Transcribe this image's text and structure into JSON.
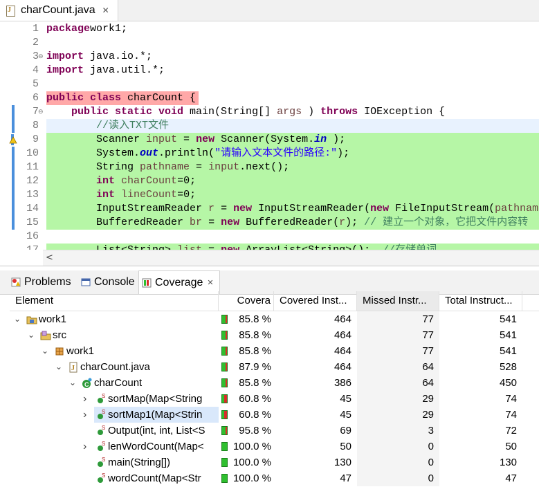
{
  "editor": {
    "tab_title": "charCount.java",
    "tab_close": "✕",
    "lines": [
      {
        "n": "1",
        "bg": "",
        "segs": [
          [
            "kw",
            "package"
          ],
          [
            "",
            "work1;"
          ]
        ]
      },
      {
        "n": "2",
        "bg": "",
        "segs": []
      },
      {
        "n": "3",
        "bg": "",
        "fold": "⊖",
        "segs": [
          [
            "kw",
            "import"
          ],
          [
            "",
            " java.io.*;"
          ]
        ]
      },
      {
        "n": "4",
        "bg": "",
        "segs": [
          [
            "kw",
            "import"
          ],
          [
            "",
            " java.util.*;"
          ]
        ]
      },
      {
        "n": "5",
        "bg": "",
        "segs": []
      },
      {
        "n": "6",
        "bg": "red",
        "segs": [
          [
            "kw",
            "public class"
          ],
          [
            "",
            " charCount {"
          ]
        ]
      },
      {
        "n": "7",
        "bg": "",
        "fold": "⊖",
        "mark": "bar",
        "segs": [
          [
            "",
            "    "
          ],
          [
            "kw",
            "public static void"
          ],
          [
            "",
            " main(String[] "
          ],
          [
            "lv",
            "args"
          ],
          [
            "",
            " ) "
          ],
          [
            "kw",
            "throws"
          ],
          [
            "",
            " IOException {"
          ]
        ]
      },
      {
        "n": "8",
        "bg": "cur",
        "mark": "bar",
        "segs": [
          [
            "",
            "        "
          ],
          [
            "cm",
            "//读入TXT文件"
          ]
        ]
      },
      {
        "n": "9",
        "bg": "green",
        "mark": "warn",
        "segs": [
          [
            "",
            "        Scanner "
          ],
          [
            "lv",
            "input"
          ],
          [
            "",
            " = "
          ],
          [
            "kw",
            "new"
          ],
          [
            "",
            " Scanner(System."
          ],
          [
            "fld",
            "in"
          ],
          [
            "",
            " );"
          ]
        ]
      },
      {
        "n": "10",
        "bg": "green",
        "mark": "bar",
        "segs": [
          [
            "",
            "        System."
          ],
          [
            "fld",
            "out"
          ],
          [
            "",
            ".println("
          ],
          [
            "st",
            "\"请输入文本文件的路径:\""
          ],
          [
            "",
            ");"
          ]
        ]
      },
      {
        "n": "11",
        "bg": "green",
        "mark": "bar",
        "segs": [
          [
            "",
            "        String "
          ],
          [
            "lv",
            "pathname"
          ],
          [
            "",
            " = "
          ],
          [
            "lv",
            "input"
          ],
          [
            "",
            ".next();"
          ]
        ]
      },
      {
        "n": "12",
        "bg": "green",
        "mark": "bar",
        "segs": [
          [
            "",
            "        "
          ],
          [
            "kw",
            "int"
          ],
          [
            "",
            " "
          ],
          [
            "lv",
            "charCount"
          ],
          [
            "",
            "=0;"
          ]
        ]
      },
      {
        "n": "13",
        "bg": "green",
        "mark": "bar",
        "segs": [
          [
            "",
            "        "
          ],
          [
            "kw",
            "int"
          ],
          [
            "",
            " "
          ],
          [
            "lv",
            "lineCount"
          ],
          [
            "",
            "=0;"
          ]
        ]
      },
      {
        "n": "14",
        "bg": "green",
        "mark": "bar",
        "segs": [
          [
            "",
            "        InputStreamReader "
          ],
          [
            "lv",
            "r"
          ],
          [
            "",
            " = "
          ],
          [
            "kw",
            "new"
          ],
          [
            "",
            " InputStreamReader("
          ],
          [
            "kw",
            "new"
          ],
          [
            "",
            " FileInputStream("
          ],
          [
            "lv",
            "pathnam"
          ]
        ]
      },
      {
        "n": "15",
        "bg": "green",
        "mark": "bar",
        "segs": [
          [
            "",
            "        BufferedReader "
          ],
          [
            "lv",
            "br"
          ],
          [
            "",
            " = "
          ],
          [
            "kw",
            "new"
          ],
          [
            "",
            " BufferedReader("
          ],
          [
            "lv",
            "r"
          ],
          [
            "",
            "); "
          ],
          [
            "cm",
            "// 建立一个对象，它把文件内容转"
          ]
        ]
      },
      {
        "n": "16",
        "bg": "",
        "segs": []
      },
      {
        "n": "17",
        "bg": "green",
        "segs": [
          [
            "",
            "        List<String> "
          ],
          [
            "lv",
            "list"
          ],
          [
            "",
            " = "
          ],
          [
            "kw",
            "new"
          ],
          [
            "",
            " ArrayList<String>();  "
          ],
          [
            "cm",
            "//存储单词"
          ]
        ]
      }
    ],
    "hscroll_arrow": "<"
  },
  "views": {
    "tabs": [
      {
        "label": "Problems",
        "icon": "problems-icon",
        "active": false
      },
      {
        "label": "Console",
        "icon": "console-icon",
        "active": false
      },
      {
        "label": "Coverage",
        "icon": "coverage-icon",
        "active": true,
        "close": "✕"
      }
    ],
    "columns": [
      "Element",
      "Covera",
      "Covered Inst...",
      "Missed Instr...",
      "Total Instruct..."
    ],
    "rows": [
      {
        "indent": 0,
        "twisty": "⌄",
        "icon": "project-icon",
        "name": "work1",
        "coverage": "85.8 %",
        "miss_frac": 0.142,
        "covered": "464",
        "missed": "77",
        "total": "541"
      },
      {
        "indent": 1,
        "twisty": "⌄",
        "icon": "source-folder-icon",
        "name": "src",
        "coverage": "85.8 %",
        "miss_frac": 0.142,
        "covered": "464",
        "missed": "77",
        "total": "541"
      },
      {
        "indent": 2,
        "twisty": "⌄",
        "icon": "package-icon",
        "name": "work1",
        "coverage": "85.8 %",
        "miss_frac": 0.142,
        "covered": "464",
        "missed": "77",
        "total": "541"
      },
      {
        "indent": 3,
        "twisty": "⌄",
        "icon": "java-file-icon",
        "name": "charCount.java",
        "coverage": "87.9 %",
        "miss_frac": 0.121,
        "covered": "464",
        "missed": "64",
        "total": "528"
      },
      {
        "indent": 4,
        "twisty": "⌄",
        "icon": "class-icon",
        "name": "charCount",
        "coverage": "85.8 %",
        "miss_frac": 0.142,
        "covered": "386",
        "missed": "64",
        "total": "450"
      },
      {
        "indent": 5,
        "twisty": "›",
        "icon": "static-method-icon",
        "name": "sortMap(Map<String",
        "coverage": "60.8 %",
        "miss_frac": 0.392,
        "covered": "45",
        "missed": "29",
        "total": "74"
      },
      {
        "indent": 5,
        "twisty": "›",
        "icon": "static-method-icon",
        "name": "sortMap1(Map<Strin",
        "coverage": "60.8 %",
        "miss_frac": 0.392,
        "covered": "45",
        "missed": "29",
        "total": "74",
        "selected": true
      },
      {
        "indent": 5,
        "twisty": "",
        "icon": "static-method-icon",
        "name": "Output(int, int, List<S",
        "coverage": "95.8 %",
        "miss_frac": 0.042,
        "covered": "69",
        "missed": "3",
        "total": "72"
      },
      {
        "indent": 5,
        "twisty": "›",
        "icon": "static-method-icon",
        "name": "lenWordCount(Map<",
        "coverage": "100.0 %",
        "miss_frac": 0,
        "covered": "50",
        "missed": "0",
        "total": "50"
      },
      {
        "indent": 5,
        "twisty": "",
        "icon": "static-method-icon",
        "name": "main(String[])",
        "coverage": "100.0 %",
        "miss_frac": 0,
        "covered": "130",
        "missed": "0",
        "total": "130"
      },
      {
        "indent": 5,
        "twisty": "",
        "icon": "static-method-icon",
        "name": "wordCount(Map<Str",
        "coverage": "100.0 %",
        "miss_frac": 0,
        "covered": "47",
        "missed": "0",
        "total": "47"
      }
    ]
  }
}
